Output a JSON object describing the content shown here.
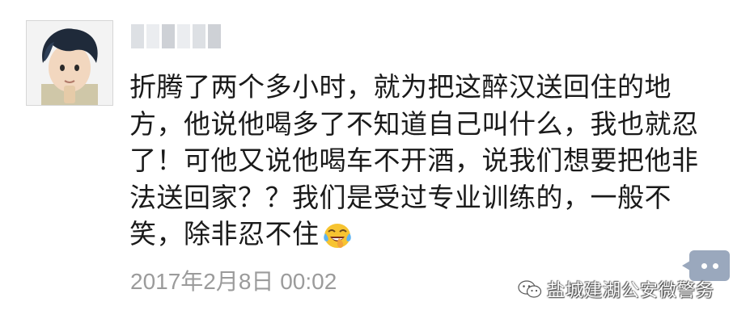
{
  "post": {
    "author_avatar_icon": "cartoon-boy-avatar-icon",
    "author_name_redacted": true,
    "text": "折腾了两个多小时，就为把这醉汉送回住的地方，他说他喝多了不知道自己叫什么，我也就忍了！可他又说他喝车不开酒，说我们想要把他非法送回家？？我们是受过专业训练的，一般不笑，除非忍不住",
    "emoji": "laughing-crying-emoji-icon",
    "timestamp": "2017年2月8日 00:02",
    "comment_button_icon": "comment-dots-icon"
  },
  "watermark": {
    "icon": "wechat-icon",
    "text": "盐城建湖公安微警务"
  },
  "colors": {
    "text": "#1a1a1a",
    "timestamp": "#9b9b9b",
    "comment_button": "#9aa8bd",
    "background": "#ffffff"
  }
}
